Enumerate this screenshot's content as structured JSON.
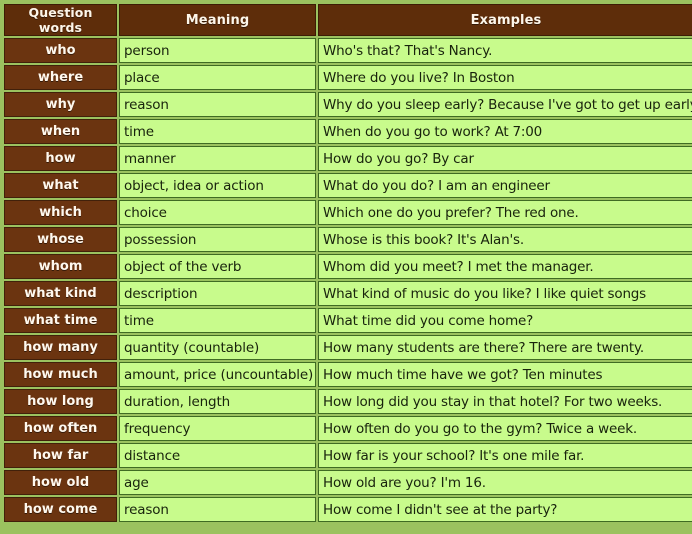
{
  "table": {
    "headers": {
      "word": "Question words",
      "meaning": "Meaning",
      "examples": "Examples"
    },
    "rows": [
      {
        "word": "who",
        "meaning": "person",
        "example": "Who's that? That's Nancy."
      },
      {
        "word": "where",
        "meaning": "place",
        "example": "Where do you live? In Boston"
      },
      {
        "word": "why",
        "meaning": "reason",
        "example": "Why do you sleep early? Because I've got to get up early"
      },
      {
        "word": "when",
        "meaning": "time",
        "example": "When do you go to work? At 7:00"
      },
      {
        "word": "how",
        "meaning": "manner",
        "example": "How do you go? By car"
      },
      {
        "word": "what",
        "meaning": "object, idea or action",
        "example": "What do you do? I am an engineer"
      },
      {
        "word": "which",
        "meaning": "choice",
        "example": "Which one do you prefer? The red one."
      },
      {
        "word": "whose",
        "meaning": "possession",
        "example": "Whose is this book? It's Alan's."
      },
      {
        "word": "whom",
        "meaning": "object of the verb",
        "example": "Whom did you meet? I met the manager."
      },
      {
        "word": "what kind",
        "meaning": "description",
        "example": "What kind of music do you like? I like quiet songs"
      },
      {
        "word": "what time",
        "meaning": "time",
        "example": "What time did you come home?"
      },
      {
        "word": "how many",
        "meaning": "quantity (countable)",
        "example": "How many students are there? There are twenty."
      },
      {
        "word": "how much",
        "meaning": "amount, price (uncountable)",
        "example": "How much time have we got? Ten minutes"
      },
      {
        "word": "how long",
        "meaning": "duration, length",
        "example": "How long did you stay in that hotel? For two weeks."
      },
      {
        "word": "how often",
        "meaning": "frequency",
        "example": "How often do you go to the gym? Twice a week."
      },
      {
        "word": "how far",
        "meaning": "distance",
        "example": "How far is your school? It's one mile far."
      },
      {
        "word": "how old",
        "meaning": "age",
        "example": "How old are you? I'm 16."
      },
      {
        "word": "how come",
        "meaning": "reason",
        "example": "How come I didn't see at the party?"
      }
    ]
  },
  "colors": {
    "header_brown": "#5e2d0a",
    "word_brown": "#6b3410",
    "cell_green": "#c8fb8c",
    "page_green": "#9bc25f",
    "grid_green": "#3f6b23"
  }
}
